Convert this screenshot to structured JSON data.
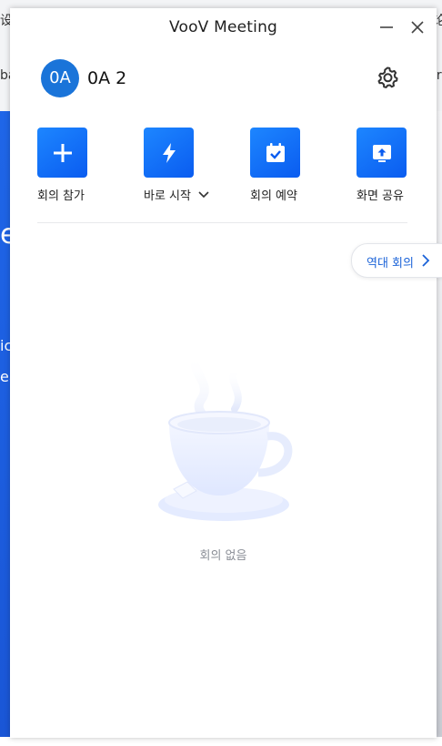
{
  "window": {
    "title": "VooV Meeting"
  },
  "background": {
    "top_left": "设",
    "top_right": "论",
    "left_edge": "ba",
    "right_edge": "lr",
    "big_letter": "e",
    "line1": "ic",
    "line2": "ea"
  },
  "user": {
    "avatar_text": "0A",
    "name": "0A 2"
  },
  "actions": [
    {
      "label": "회의 참가",
      "icon": "plus-icon"
    },
    {
      "label": "바로 시작",
      "icon": "lightning-icon",
      "has_dropdown": true
    },
    {
      "label": "회의 예약",
      "icon": "calendar-check-icon"
    },
    {
      "label": "화면 공유",
      "icon": "share-screen-icon"
    }
  ],
  "history": {
    "label": "역대 회의"
  },
  "empty_state": {
    "text": "회의 없음",
    "icon": "coffee-cup-icon"
  },
  "colors": {
    "accent": "#0a5cf0",
    "avatar": "#1a74d9",
    "link": "#1b63d8"
  }
}
